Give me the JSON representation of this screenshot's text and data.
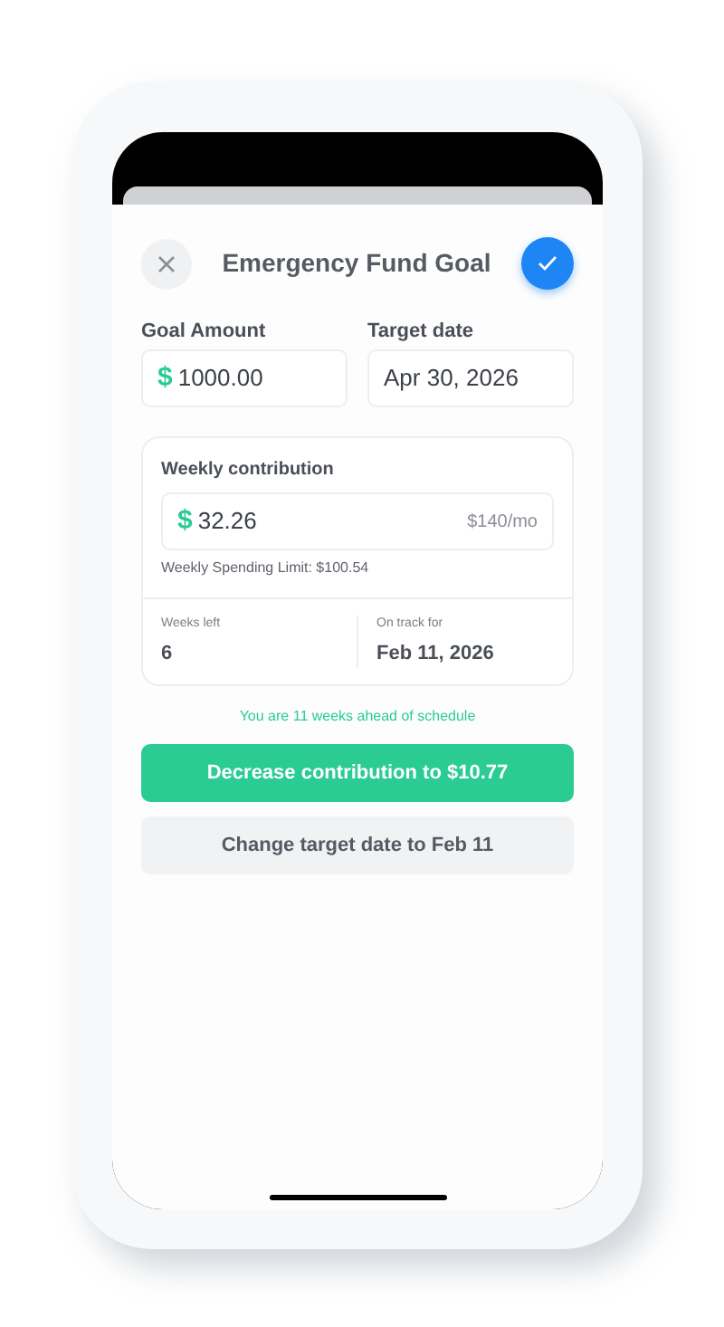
{
  "header": {
    "title": "Emergency Fund Goal"
  },
  "goal_amount": {
    "label": "Goal Amount",
    "currency": "$",
    "value": "1000.00"
  },
  "target_date": {
    "label": "Target date",
    "value": "Apr 30, 2026"
  },
  "weekly_contribution": {
    "label": "Weekly contribution",
    "currency": "$",
    "value": "32.26",
    "monthly": "$140/mo",
    "spending_limit": "Weekly Spending Limit: $100.54",
    "stats": [
      {
        "label": "Weeks left",
        "value": "6"
      },
      {
        "label": "On track for",
        "value": "Feb 11, 2026"
      }
    ]
  },
  "status_message": "You are 11 weeks ahead of schedule",
  "buttons": [
    {
      "kind": "primary",
      "label": "Decrease contribution to $10.77"
    },
    {
      "kind": "secondary",
      "label": "Change target date to Feb 11"
    }
  ]
}
